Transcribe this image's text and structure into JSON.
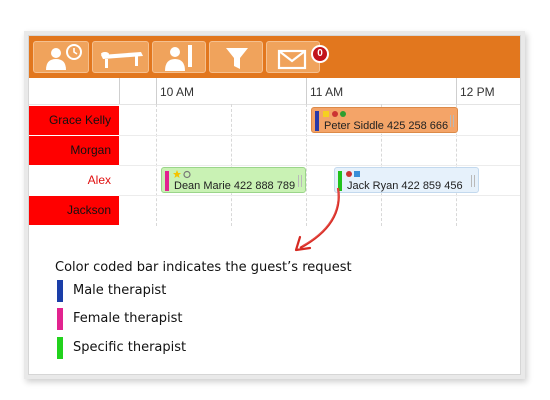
{
  "toolbar": {
    "buttons": [
      {
        "icon": "guest-clock-icon"
      },
      {
        "icon": "massage-table-icon"
      },
      {
        "icon": "therapist-icon"
      },
      {
        "icon": "filter-icon"
      },
      {
        "icon": "mail-icon"
      }
    ],
    "mail_badge": "0"
  },
  "timeline": {
    "hours": [
      "10 AM",
      "11 AM",
      "12 PM"
    ]
  },
  "therapists": [
    {
      "name": "Grace Kelly"
    },
    {
      "name": "Morgan"
    },
    {
      "name": "Alex"
    },
    {
      "name": "Jackson"
    }
  ],
  "appointments": [
    {
      "guest": "Peter Siddle 425 258 666",
      "request": "Male therapist",
      "bar_color": "#2a3aa8",
      "background": "#f4a468"
    },
    {
      "guest": "Dean Marie 422 888 789",
      "request": "Female therapist",
      "bar_color": "#e2238f",
      "background": "#c9f2b4"
    },
    {
      "guest": "Jack Ryan  422 859 456",
      "request": "Specific therapist",
      "bar_color": "#22c21d",
      "background": "#e6f1fb"
    }
  ],
  "annotation": {
    "caption": "Color coded bar indicates the guest’s request",
    "legend": [
      {
        "label": "Male therapist",
        "color": "#1a3ea8"
      },
      {
        "label": "Female therapist",
        "color": "#e2238f"
      },
      {
        "label": "Specific therapist",
        "color": "#22d21d"
      }
    ]
  },
  "colors": {
    "toolbar": "#e2771e",
    "name_cell_red": "#ff0000",
    "arrow": "#d62a22"
  }
}
